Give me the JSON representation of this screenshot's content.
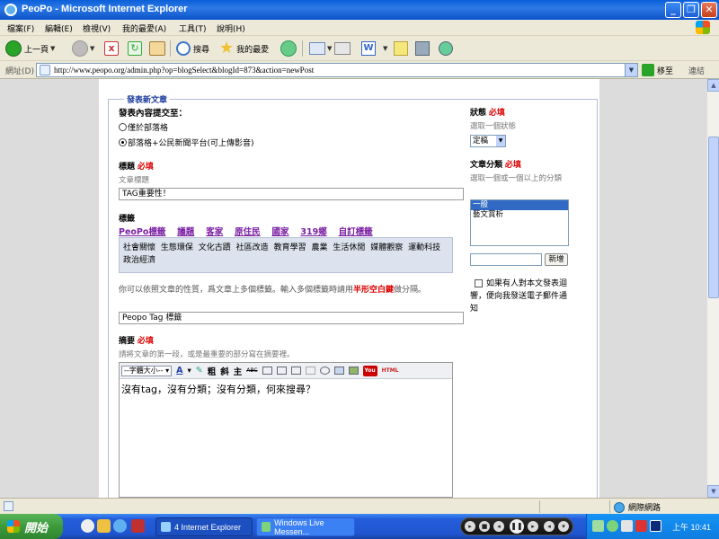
{
  "window": {
    "title": "PeoPo - Microsoft Internet Explorer",
    "minimize": "_",
    "restore": "❐",
    "close": "✕"
  },
  "menu": [
    "檔案(F)",
    "編輯(E)",
    "檢視(V)",
    "我的最愛(A)",
    "工具(T)",
    "說明(H)"
  ],
  "toolbar": {
    "back": "上一頁",
    "search": "搜尋",
    "favorites": "我的最愛"
  },
  "address": {
    "label": "網址(D)",
    "url": "http://www.peopo.org/admin.php?op=blogSelect&blogId=873&action=newPost",
    "go": "移至",
    "links": "連結"
  },
  "form": {
    "legend": "發表新文章",
    "share_heading": "發表內容提交至：",
    "share_options": [
      {
        "label": "僅於部落格",
        "selected": false
      },
      {
        "label": "部落格+公民新聞平台(可上傳影音)",
        "selected": true
      }
    ],
    "title_label": "標題",
    "required": "必填",
    "title_hint": "文章標題",
    "title_value": "TAG重要性！",
    "tags_label": "標籤",
    "tag_groups": [
      "PeoPo標籤",
      "議題",
      "客家",
      "原住民",
      "國家",
      "319鄉",
      "自訂標籤"
    ],
    "tag_options": [
      "社會關懷",
      "生態環保",
      "文化古蹟",
      "社區改造",
      "教育學習",
      "農業",
      "生活休閒",
      "媒體觀察",
      "運動科技",
      "政治經濟"
    ],
    "tag_note_pre": "你可以依照文章的性質，爲文章上多個標籤。輸入多個標籤時請用",
    "tag_note_emph": "半形空白鍵",
    "tag_note_post": "做分隔。",
    "tags_value": "Peopo Tag  標籤",
    "summary_label": "摘要",
    "summary_hint": "請將文章的第一段，或是最重要的部分寫在摘要裡。",
    "editor_fontsize": "--字體大小--",
    "editor_bold": "粗",
    "editor_italic": "斜",
    "editor_underline": "主",
    "editor_strike": "ABC",
    "editor_yt": "You",
    "editor_html": "HTML",
    "summary_value": "沒有tag，沒有分類；沒有分類，何來搜尋？"
  },
  "sidebar": {
    "status_label": "狀態",
    "status_hint": "選取一個狀態",
    "status_value": "定稿",
    "category_label": "文章分類",
    "category_hint": "選取一個或一個以上的分類",
    "categories": [
      {
        "label": "一般",
        "selected": true
      },
      {
        "label": "藝文賞析",
        "selected": false
      }
    ],
    "newcat_button": "新增",
    "notify_label": "如果有人對本文發表迴響，便向我發送電子郵件通知"
  },
  "statusbar": {
    "zone": "網際網路"
  },
  "taskbar": {
    "start": "開始",
    "tasks": [
      "4 Internet Explorer",
      "Windows Live Messen..."
    ],
    "clock": "上午 10:41"
  },
  "colors": {
    "required": "#dd0000",
    "tag_link": "#7a1fa2",
    "legend": "#1c3c9c",
    "selection": "#316ac5"
  }
}
